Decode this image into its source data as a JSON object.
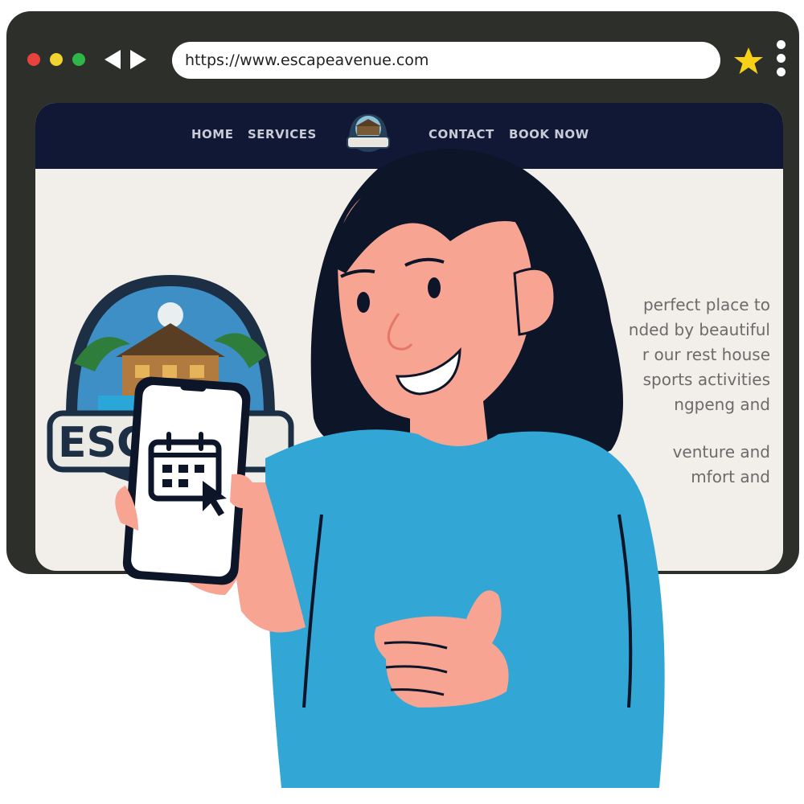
{
  "browser": {
    "url": "https://www.escapeavenue.com",
    "controls": {
      "close_color": "#e8423f",
      "minimize_color": "#f0d32e",
      "maximize_color": "#2fb64a"
    },
    "icons": [
      "back-arrow-icon",
      "forward-arrow-icon",
      "star-icon",
      "kebab-menu-icon"
    ]
  },
  "site": {
    "nav": {
      "items": [
        "HOME",
        "SERVICES",
        "CONTACT",
        "BOOK NOW"
      ],
      "background": "#101836"
    },
    "logo_text": "ESCAPE",
    "paragraph_lines": [
      "perfect place to",
      "nded by beautiful",
      "r our rest house",
      "sports activities",
      "ngpeng and"
    ],
    "paragraph_lines_2": [
      "venture and",
      "mfort and"
    ]
  },
  "illustration": {
    "phone_icon": "calendar-click-icon",
    "colors": {
      "skin": "#f7a493",
      "shirt": "#32a6d4",
      "hair": "#0d1529"
    }
  }
}
